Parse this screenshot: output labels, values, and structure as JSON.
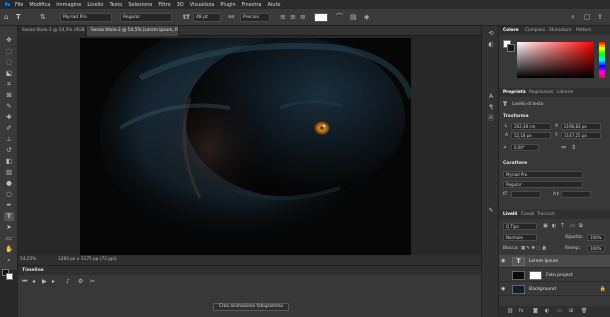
{
  "menu": [
    "File",
    "Modifica",
    "Immagine",
    "Livello",
    "Testo",
    "Selezione",
    "Filtro",
    "3D",
    "Visualizza",
    "Plugin",
    "Finestra",
    "Aiuto"
  ],
  "app": {
    "logo": "Ps"
  },
  "options": {
    "font_family": "Myriad Pro",
    "font_style": "Regular",
    "font_size": "48 pt",
    "aa": "aa",
    "antialias": "Preciso"
  },
  "tabs": [
    {
      "label": "Senza titolo-1 @ 54,5% (RGB/8)",
      "active": false
    },
    {
      "label": "Senza titolo-2 @ 54,5% (Lorem Ipsum, RGB/8)",
      "active": true
    }
  ],
  "status": {
    "zoom": "54,55%",
    "size": "1260 px x 1175 px (72 ppi)"
  },
  "timeline": {
    "title": "Timeline",
    "create_button": "Crea animazione fotogramma"
  },
  "color_panel": {
    "tabs": [
      "Colore",
      "Campioni",
      "Sfumature",
      "Pattern"
    ],
    "active": "Colore"
  },
  "properties": {
    "tabs": [
      "Proprietà",
      "Regolazioni",
      "Librerie"
    ],
    "active": "Proprietà",
    "layer_label": "Livello di testo",
    "transform": {
      "title": "Trasforma",
      "w": "262,38 cm",
      "x": "2196,83 px",
      "h": "52,18 px",
      "y": "1147,25 px",
      "angle": "0,00°"
    },
    "character": {
      "title": "Carattere",
      "font": "Myriad Pro",
      "style": "Regular"
    }
  },
  "layers": {
    "tabs": [
      "Livelli",
      "Canali",
      "Tracciati"
    ],
    "active": "Livelli",
    "filter": "Q Tipo",
    "blend": "Normale",
    "opacity_label": "Opacità:",
    "opacity": "100%",
    "lock_label": "Blocca:",
    "fill_label": "Riemp.:",
    "fill": "100%",
    "items": [
      {
        "name": "Lorem Ipsum",
        "selected": true,
        "type": "text"
      },
      {
        "name": "Foto project",
        "selected": false,
        "type": "mask"
      },
      {
        "name": "Background",
        "selected": false,
        "type": "photo"
      }
    ]
  },
  "colors": {
    "accent": "#31a8ff",
    "eye": "#d98a1e",
    "fur": "#2d4e63"
  }
}
